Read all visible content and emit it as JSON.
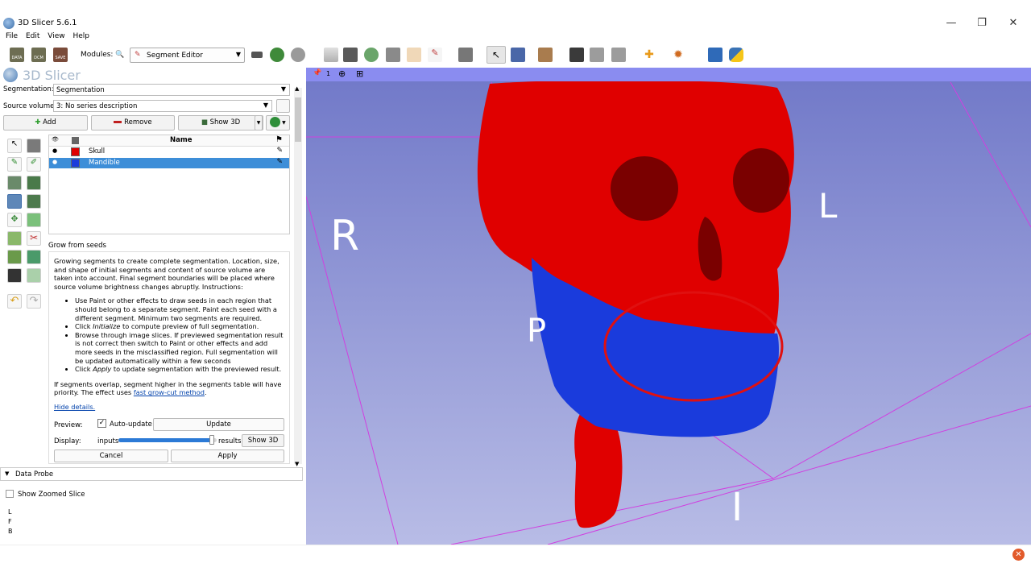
{
  "window": {
    "title": "3D Slicer 5.6.1",
    "minimize": "—",
    "restore": "❐",
    "close": "✕"
  },
  "menu": [
    "File",
    "Edit",
    "View",
    "Help"
  ],
  "toolbar": {
    "modules_label": "Modules:",
    "module_selected": "Segment Editor",
    "data_icon_label": "DATA",
    "dcm_icon_label": "DCM",
    "save_icon_label": "SAVE"
  },
  "panel": {
    "brand": "3D Slicer",
    "segmentation_label": "Segmentation:",
    "segmentation_value": "Segmentation",
    "source_label": "Source volume:",
    "source_value": "3: No series description",
    "add_label": "Add",
    "remove_label": "Remove",
    "show3d_label": "Show 3D",
    "table_header_name": "Name",
    "segments": [
      {
        "name": "Skull",
        "color": "#e00000",
        "selected": false
      },
      {
        "name": "Mandible",
        "color": "#1a3bdc",
        "selected": true
      }
    ],
    "effect_title": "Grow from seeds",
    "help": {
      "intro": "Growing segments to create complete segmentation. Location, size, and shape of initial segments and content of source volume are taken into account. Final segment boundaries will be placed where source volume brightness changes abruptly. Instructions:",
      "bullet1": "Use Paint or other effects to draw seeds in each region that should belong to a separate segment. Paint each seed with a different segment. Minimum two segments are required.",
      "bullet2_pre": "Click ",
      "bullet2_em": "Initialize",
      "bullet2_post": " to compute preview of full segmentation.",
      "bullet3": "Browse through image slices. If previewed segmentation result is not correct then switch to Paint or other effects and add more seeds in the misclassified region. Full segmentation will be updated automatically within a few seconds",
      "bullet4_pre": "Click ",
      "bullet4_em": "Apply",
      "bullet4_post": " to update segmentation with the previewed result.",
      "overlap": "If segments overlap, segment higher in the segments table will have priority. The effect uses ",
      "overlap_link": "fast grow-cut method",
      "overlap_end": ".",
      "hide_details": "Hide details."
    },
    "preview_label": "Preview:",
    "auto_update_label": "Auto-update",
    "auto_update_checked": true,
    "update_label": "Update",
    "display_label": "Display:",
    "inputs_label": "inputs",
    "results_label": "results",
    "display_level": 0.95,
    "display_show3d": "Show 3D",
    "cancel_label": "Cancel",
    "apply_label": "Apply",
    "data_probe_label": "Data Probe",
    "show_zoomed_label": "Show Zoomed Slice",
    "probe_lines": [
      "L",
      "F",
      "B"
    ]
  },
  "view": {
    "bar_number": "1",
    "orientation": {
      "R": "R",
      "L": "L",
      "P": "P",
      "I": "I"
    },
    "colors": {
      "skull": "#e00000",
      "mandible": "#1a3bdc",
      "highlight": "#e01010",
      "box": "#d040e0"
    }
  }
}
